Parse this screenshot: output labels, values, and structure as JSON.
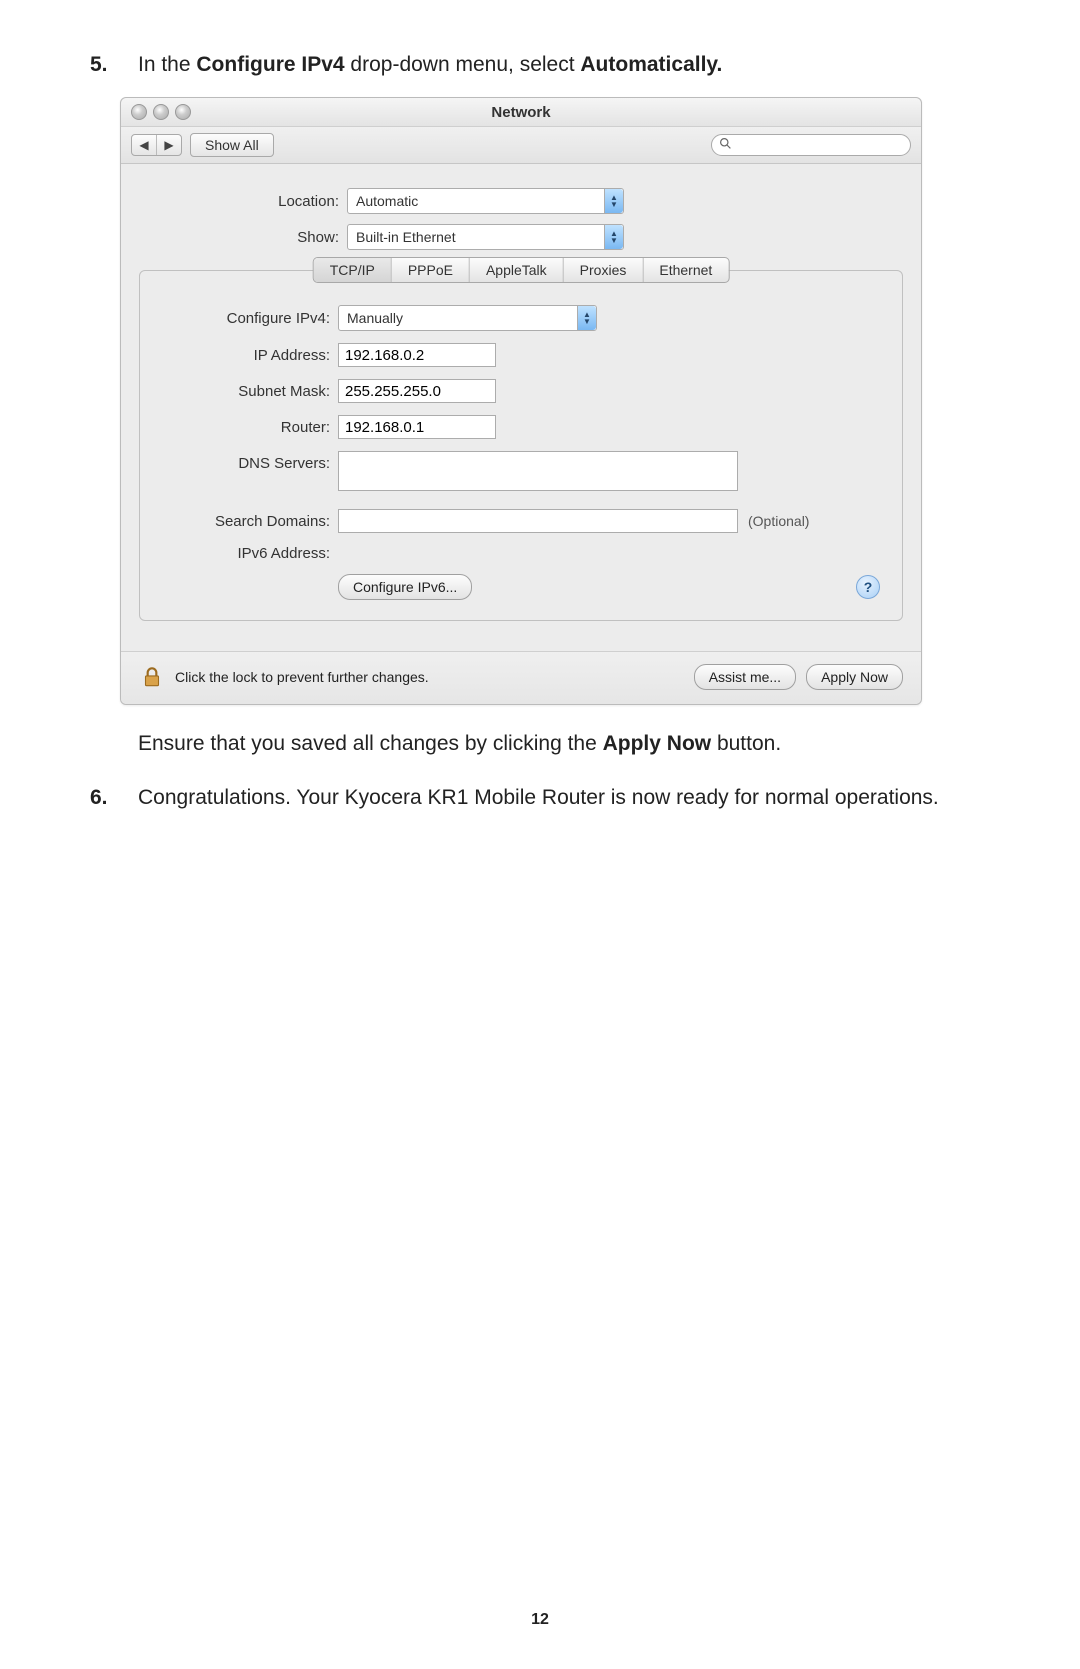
{
  "step5": {
    "num": "5.",
    "text_pre": "In the ",
    "text_bold1": "Configure IPv4",
    "text_mid": " drop-down menu, select ",
    "text_bold2": "Automatically."
  },
  "window": {
    "title": "Network",
    "toolbar": {
      "back_icon": "◀",
      "fwd_icon": "▶",
      "show_all": "Show All",
      "search_placeholder": ""
    },
    "location_label": "Location:",
    "location_value": "Automatic",
    "show_label": "Show:",
    "show_value": "Built-in Ethernet",
    "tabs": [
      "TCP/IP",
      "PPPoE",
      "AppleTalk",
      "Proxies",
      "Ethernet"
    ],
    "active_tab_index": 0,
    "fields": {
      "configure_ipv4_label": "Configure IPv4:",
      "configure_ipv4_value": "Manually",
      "ip_address_label": "IP Address:",
      "ip_address_value": "192.168.0.2",
      "subnet_mask_label": "Subnet Mask:",
      "subnet_mask_value": "255.255.255.0",
      "router_label": "Router:",
      "router_value": "192.168.0.1",
      "dns_label": "DNS Servers:",
      "dns_value": "",
      "search_domains_label": "Search Domains:",
      "search_domains_value": "",
      "search_domains_hint": "(Optional)",
      "ipv6_addr_label": "IPv6 Address:",
      "configure_ipv6_btn": "Configure IPv6...",
      "help_symbol": "?"
    },
    "footer": {
      "lock_text": "Click the lock to prevent further changes.",
      "assist_btn": "Assist me...",
      "apply_btn": "Apply Now"
    }
  },
  "after_para_pre": "Ensure that you saved all changes by clicking the ",
  "after_para_bold": "Apply Now",
  "after_para_post": " button.",
  "step6": {
    "num": "6.",
    "text": "Congratulations. Your Kyocera KR1 Mobile Router is now ready for normal operations."
  },
  "page_number": "12"
}
